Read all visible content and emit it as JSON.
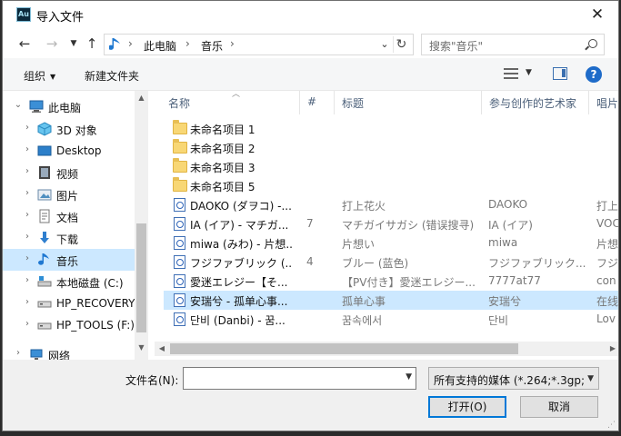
{
  "app": {
    "icon_text": "Au",
    "title": "导入文件"
  },
  "address": {
    "crumbs": [
      "此电脑",
      "音乐"
    ],
    "separator": "›"
  },
  "search": {
    "placeholder": "搜索\"音乐\""
  },
  "toolbar": {
    "organize": "组织",
    "new_folder": "新建文件夹"
  },
  "sidebar": {
    "items": [
      {
        "label": "此电脑",
        "icon": "computer-icon",
        "expanded": true
      },
      {
        "label": "3D 对象",
        "icon": "cube-3d-icon"
      },
      {
        "label": "Desktop",
        "icon": "desktop-icon"
      },
      {
        "label": "视频",
        "icon": "video-icon"
      },
      {
        "label": "图片",
        "icon": "pictures-icon"
      },
      {
        "label": "文档",
        "icon": "documents-icon"
      },
      {
        "label": "下载",
        "icon": "download-icon"
      },
      {
        "label": "音乐",
        "icon": "music-icon",
        "selected": true
      },
      {
        "label": "本地磁盘 (C:)",
        "icon": "drive-icon"
      },
      {
        "label": "HP_RECOVERY",
        "icon": "drive-icon"
      },
      {
        "label": "HP_TOOLS (F:)",
        "icon": "drive-icon"
      },
      {
        "label": "网络",
        "icon": "network-icon"
      }
    ]
  },
  "columns": [
    "名称",
    "#",
    "标题",
    "参与创作的艺术家",
    "唱片"
  ],
  "files": [
    {
      "type": "folder",
      "name": "未命名项目 1",
      "num": "",
      "title": "",
      "artist": "",
      "album": ""
    },
    {
      "type": "folder",
      "name": "未命名项目 2",
      "num": "",
      "title": "",
      "artist": "",
      "album": ""
    },
    {
      "type": "folder",
      "name": "未命名项目 3",
      "num": "",
      "title": "",
      "artist": "",
      "album": ""
    },
    {
      "type": "folder",
      "name": "未命名项目 5",
      "num": "",
      "title": "",
      "artist": "",
      "album": ""
    },
    {
      "type": "media",
      "name": "DAOKO (ダヲコ) -...",
      "num": "",
      "title": "打上花火",
      "artist": "DAOKO",
      "album": "打上"
    },
    {
      "type": "media",
      "name": "IA (イア) - マチガ...",
      "num": "7",
      "title": "マチガイサガシ (错误搜寻)",
      "artist": "IA (イア)",
      "album": "VOC"
    },
    {
      "type": "media",
      "name": "miwa (みわ) - 片想...",
      "num": "",
      "title": "片想い",
      "artist": "miwa",
      "album": "片想"
    },
    {
      "type": "media",
      "name": "フジファブリック (...",
      "num": "4",
      "title": "ブルー (蓝色)",
      "artist": "フジファブリック...",
      "album": "フジ"
    },
    {
      "type": "media",
      "name": "愛迷エレジー【そ...",
      "num": "",
      "title": "【PV付き】愛迷エレジー...",
      "artist": "7777at77",
      "album": "con"
    },
    {
      "type": "media",
      "name": "安瑞兮 - 孤单心事...",
      "num": "",
      "title": "孤单心事",
      "artist": "安瑞兮",
      "album": "在线",
      "selected": true
    },
    {
      "type": "media",
      "name": "단비 (Danbi) - 꿈...",
      "num": "",
      "title": "꿈속에서",
      "artist": "단비",
      "album": "Lov"
    }
  ],
  "bottom": {
    "filename_label": "文件名(N):",
    "filename_value": "",
    "filetype": "所有支持的媒体 (*.264;*.3gp;*",
    "open_button": "打开(O)",
    "cancel_button": "取消"
  }
}
